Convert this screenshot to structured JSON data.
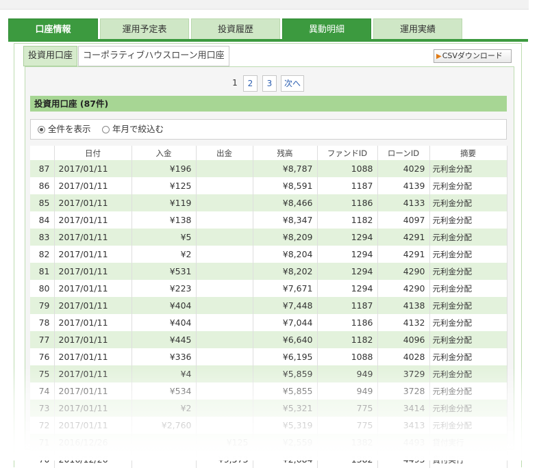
{
  "main_tabs": [
    "口座情報",
    "運用予定表",
    "投資履歴",
    "異動明細",
    "運用実績"
  ],
  "sub_tabs": [
    "投資用口座",
    "コーポラティブハウスローン用口座"
  ],
  "csv_button": "CSVダウンロード",
  "pagination": {
    "pages": [
      "1",
      "2",
      "3"
    ],
    "current": "1",
    "next": "次へ"
  },
  "section_title": "投資用口座 (87件)",
  "filter": {
    "all": "全件を表示",
    "month": "年月で絞込む"
  },
  "columns": [
    "",
    "日付",
    "入金",
    "出金",
    "残高",
    "ファンドID",
    "ローンID",
    "摘要"
  ],
  "rows": [
    [
      "87",
      "2017/01/11",
      "¥196",
      "",
      "¥8,787",
      "1088",
      "4029",
      "元利金分配"
    ],
    [
      "86",
      "2017/01/11",
      "¥125",
      "",
      "¥8,591",
      "1187",
      "4139",
      "元利金分配"
    ],
    [
      "85",
      "2017/01/11",
      "¥119",
      "",
      "¥8,466",
      "1186",
      "4133",
      "元利金分配"
    ],
    [
      "84",
      "2017/01/11",
      "¥138",
      "",
      "¥8,347",
      "1182",
      "4097",
      "元利金分配"
    ],
    [
      "83",
      "2017/01/11",
      "¥5",
      "",
      "¥8,209",
      "1294",
      "4291",
      "元利金分配"
    ],
    [
      "82",
      "2017/01/11",
      "¥2",
      "",
      "¥8,204",
      "1294",
      "4291",
      "元利金分配"
    ],
    [
      "81",
      "2017/01/11",
      "¥531",
      "",
      "¥8,202",
      "1294",
      "4290",
      "元利金分配"
    ],
    [
      "80",
      "2017/01/11",
      "¥223",
      "",
      "¥7,671",
      "1294",
      "4290",
      "元利金分配"
    ],
    [
      "79",
      "2017/01/11",
      "¥404",
      "",
      "¥7,448",
      "1187",
      "4138",
      "元利金分配"
    ],
    [
      "78",
      "2017/01/11",
      "¥404",
      "",
      "¥7,044",
      "1186",
      "4132",
      "元利金分配"
    ],
    [
      "77",
      "2017/01/11",
      "¥445",
      "",
      "¥6,640",
      "1182",
      "4096",
      "元利金分配"
    ],
    [
      "76",
      "2017/01/11",
      "¥336",
      "",
      "¥6,195",
      "1088",
      "4028",
      "元利金分配"
    ],
    [
      "75",
      "2017/01/11",
      "¥4",
      "",
      "¥5,859",
      "949",
      "3729",
      "元利金分配"
    ],
    [
      "74",
      "2017/01/11",
      "¥534",
      "",
      "¥5,855",
      "949",
      "3728",
      "元利金分配"
    ],
    [
      "73",
      "2017/01/11",
      "¥2",
      "",
      "¥5,321",
      "775",
      "3414",
      "元利金分配"
    ],
    [
      "72",
      "2017/01/11",
      "¥2,760",
      "",
      "¥5,319",
      "775",
      "3413",
      "元利金分配"
    ],
    [
      "71",
      "2016/12/26",
      "",
      "¥125",
      "¥2,559",
      "1382",
      "4493",
      "貸付実行"
    ],
    [
      "70",
      "2016/12/26",
      "",
      "¥9,573",
      "¥2,684",
      "1382",
      "4493",
      "貸付実行"
    ]
  ],
  "colors": {
    "tab_active": "#3c9a3f",
    "tab_inactive": "#cfe7c6",
    "row_alt": "#e3f2dc",
    "section_bar": "#a7d694"
  }
}
